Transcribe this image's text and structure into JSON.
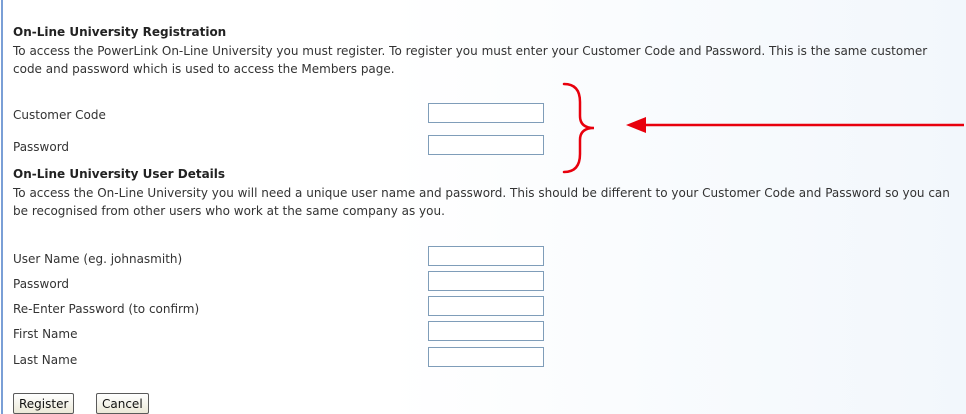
{
  "registration": {
    "heading": "On-Line University Registration",
    "description": "To access the PowerLink On-Line University you must register. To register you must enter your Customer Code and Password. This is the same customer code and password which is used to access the Members page.",
    "fields": {
      "customer_code": {
        "label": "Customer Code",
        "value": ""
      },
      "password": {
        "label": "Password",
        "value": ""
      }
    }
  },
  "user_details": {
    "heading": "On-Line University User Details",
    "description": "To access the On-Line University you will need a unique user name and password. This should be different to your Customer Code and Password so you can be recognised from other users who work at the same company as you.",
    "fields": {
      "user_name": {
        "label": "User Name (eg. johnasmith)",
        "value": ""
      },
      "password": {
        "label": "Password",
        "value": ""
      },
      "confirm_password": {
        "label": "Re-Enter Password (to confirm)",
        "value": ""
      },
      "first_name": {
        "label": "First Name",
        "value": ""
      },
      "last_name": {
        "label": "Last Name",
        "value": ""
      }
    }
  },
  "actions": {
    "register_label": "Register",
    "cancel_label": "Cancel"
  },
  "colors": {
    "annotation": "#e8000d",
    "input_border": "#7f9db9",
    "page_rule": "#7a9fd6"
  },
  "icons": {
    "annotation_brace": "curly-brace-icon",
    "annotation_arrow": "left-arrow-icon"
  }
}
